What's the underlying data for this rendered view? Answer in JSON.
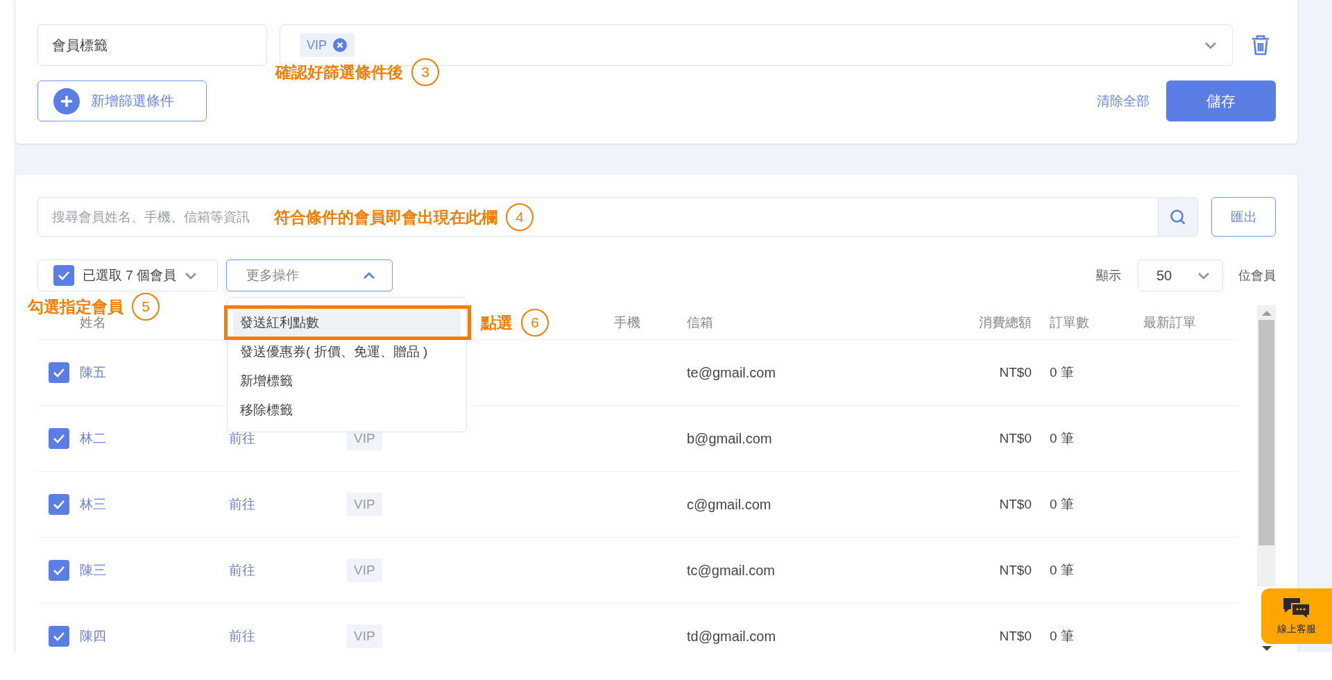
{
  "filter": {
    "field": "會員標籤",
    "tags": [
      {
        "label": "VIP"
      }
    ],
    "add_button": "新增篩選條件",
    "note": {
      "text": "確認好篩選條件後",
      "number": "3"
    },
    "clear_all": "清除全部",
    "save": "儲存"
  },
  "members": {
    "search": {
      "placeholder": "搜尋會員姓名、手機、信箱等資訊",
      "note": {
        "text": "符合條件的會員即會出現在此欄",
        "number": "4"
      }
    },
    "export": "匯出",
    "selection": {
      "checked": true,
      "label": "已選取 7 個會員",
      "note": {
        "text": "勾選指定會員",
        "number": "5"
      }
    },
    "more_actions": {
      "label": "更多操作",
      "expanded": true,
      "note": {
        "text": "點選",
        "number": "6"
      },
      "items": [
        {
          "label": "發送紅利點數",
          "selected": true
        },
        {
          "label": "發送優惠券( 折價、免運、贈品 )",
          "selected": false
        },
        {
          "label": "新增標籤",
          "selected": false
        },
        {
          "label": "移除標籤",
          "selected": false
        }
      ]
    },
    "page_size": {
      "prefix": "顯示",
      "value": "50",
      "suffix": "位會員"
    },
    "table": {
      "header": {
        "name": "姓名",
        "phone": "手機",
        "email": "信箱",
        "total": "消費總額",
        "orders": "訂單數",
        "latest": "最新訂單"
      },
      "rows": [
        {
          "checked": true,
          "name": "陳五",
          "email": "te@gmail.com",
          "total": "NT$0",
          "orders": "0 筆"
        },
        {
          "checked": true,
          "name": "林二",
          "link": "前往",
          "tag": "VIP",
          "email": "b@gmail.com",
          "total": "NT$0",
          "orders": "0 筆"
        },
        {
          "checked": true,
          "name": "林三",
          "link": "前往",
          "tag": "VIP",
          "email": "c@gmail.com",
          "total": "NT$0",
          "orders": "0 筆"
        },
        {
          "checked": true,
          "name": "陳三",
          "link": "前往",
          "tag": "VIP",
          "email": "tc@gmail.com",
          "total": "NT$0",
          "orders": "0 筆"
        },
        {
          "checked": true,
          "name": "陳四",
          "link": "前往",
          "tag": "VIP",
          "email": "td@gmail.com",
          "total": "NT$0",
          "orders": "0 筆"
        }
      ]
    }
  },
  "chat": {
    "label": "線上客服"
  }
}
